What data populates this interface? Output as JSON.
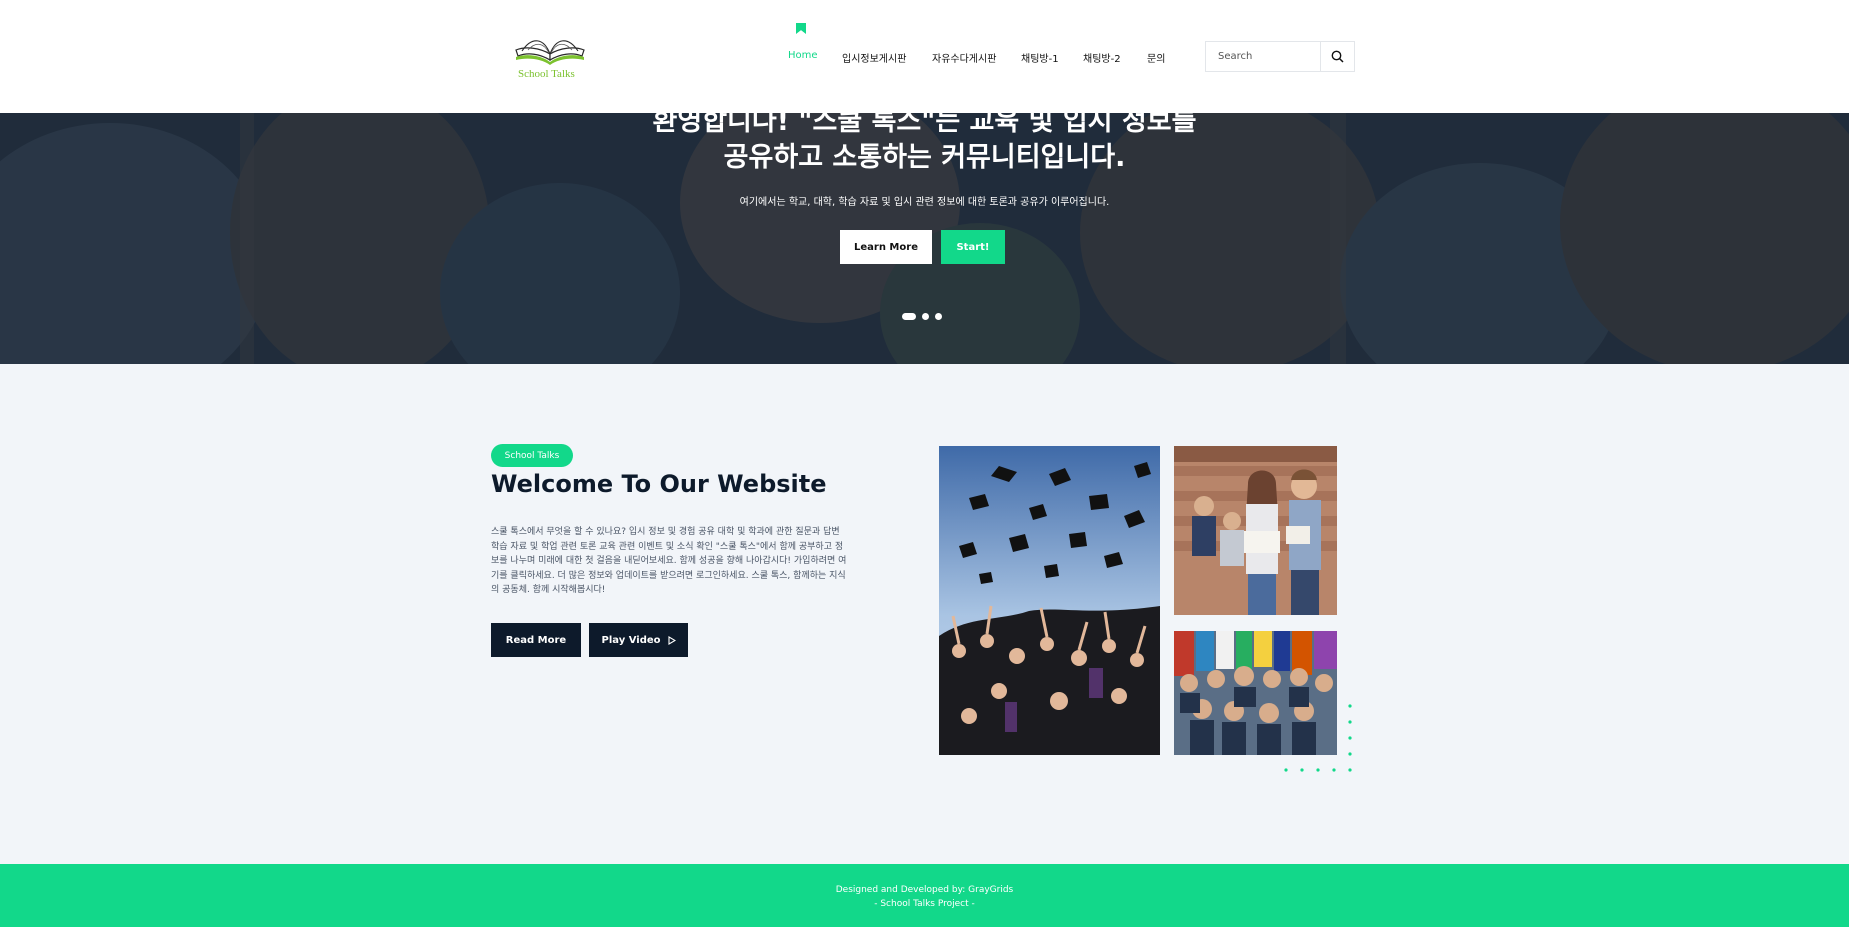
{
  "header": {
    "logo_text": "School Talks",
    "nav": [
      {
        "label": "Home",
        "active": true
      },
      {
        "label": "입시정보게시판",
        "active": false
      },
      {
        "label": "자유수다게시판",
        "active": false
      },
      {
        "label": "채팅방-1",
        "active": false
      },
      {
        "label": "채팅방-2",
        "active": false
      },
      {
        "label": "문의",
        "active": false
      }
    ],
    "search_placeholder": "Search",
    "search_icon": "search-icon"
  },
  "hero": {
    "title_line1": "환영합니다! \"스쿨 톡스\"는 교육 및 입시 정보를",
    "title_line2": "공유하고 소통하는 커뮤니티입니다.",
    "subtitle": "여기에서는 학교, 대학, 학습 자료 및 입시 관련 정보에 대한 토론과 공유가 이루어집니다.",
    "learn_more": "Learn More",
    "start": "Start!",
    "slide_count": 3,
    "active_slide": 1
  },
  "about": {
    "badge": "School Talks",
    "title": "Welcome To Our Website",
    "text": "스쿨 톡스에서 무엇을 할 수 있나요? 입시 정보 및 경험 공유 대학 및 학과에 관한 질문과 답변 학습 자료 및 학업 관련 토론 교육 관련 이벤트 및 소식 확인 \"스쿨 톡스\"에서 함께 공부하고 정보를 나누며 미래에 대한 첫 걸음을 내딛어보세요. 함께 성공을 향해 나아갑시다! 가입하려면 여기를 클릭하세요. 더 많은 정보와 업데이트를 받으려면 로그인하세요. 스쿨 톡스, 함께하는 지식의 공동체. 함께 시작해봅시다!",
    "read_more": "Read More",
    "play_video": "Play Video"
  },
  "colors": {
    "accent": "#12d88a",
    "dark": "#0d1a2b",
    "background": "#f2f5f9"
  },
  "footer": {
    "line1": "Designed and Developed by: GrayGrids",
    "line2": "- School Talks Project -"
  }
}
